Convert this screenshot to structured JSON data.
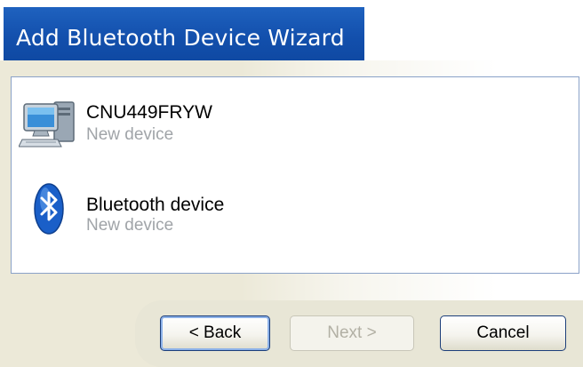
{
  "window": {
    "title": "Add Bluetooth Device Wizard"
  },
  "devices": [
    {
      "name": "CNU449FRYW",
      "status": "New device",
      "icon": "computer-icon"
    },
    {
      "name": "Bluetooth device",
      "status": "New device",
      "icon": "bluetooth-icon"
    }
  ],
  "buttons": {
    "back_label": "< Back",
    "next_label": "Next >",
    "cancel_label": "Cancel"
  },
  "colors": {
    "title_bar": "#1350ad",
    "dialog_bg": "#ece9d8",
    "bluetooth_blue": "#1a5fc8"
  }
}
